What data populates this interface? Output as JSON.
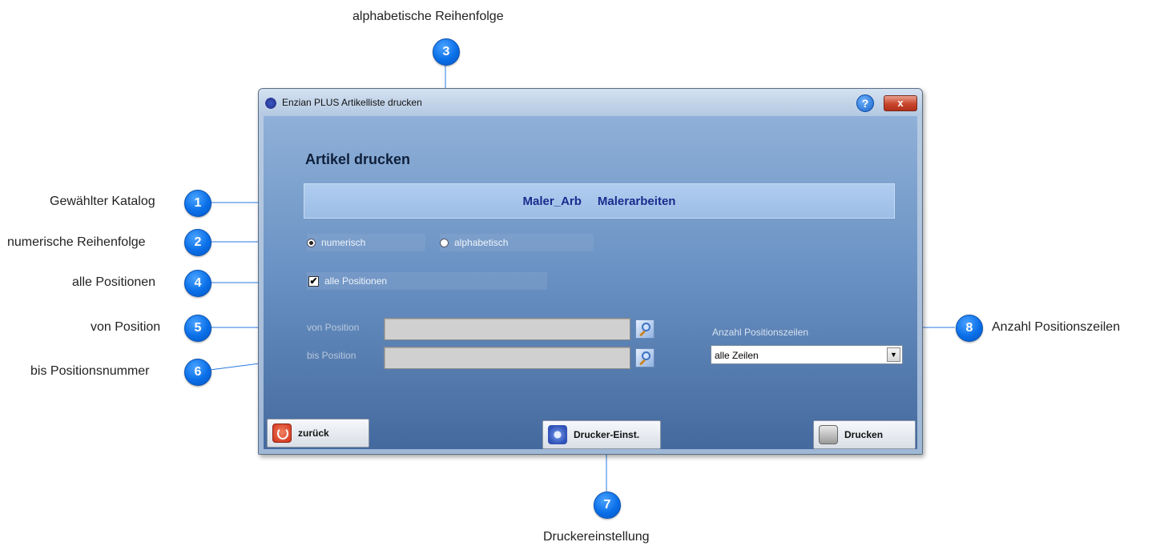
{
  "callouts": {
    "c1": {
      "number": "1",
      "label": "Gewählter Katalog"
    },
    "c2": {
      "number": "2",
      "label": "numerische Reihenfolge"
    },
    "c3": {
      "number": "3",
      "label": "alphabetische Reihenfolge"
    },
    "c4": {
      "number": "4",
      "label": "alle Positionen"
    },
    "c5": {
      "number": "5",
      "label": "von Position"
    },
    "c6": {
      "number": "6",
      "label": "bis Positionsnummer"
    },
    "c7": {
      "number": "7",
      "label": "Druckereinstellung"
    },
    "c8": {
      "number": "8",
      "label": "Anzahl Positionszeilen"
    }
  },
  "window": {
    "title": "Enzian PLUS Artikelliste drucken",
    "help_label": "?",
    "close_label": "x"
  },
  "dialog": {
    "heading": "Artikel drucken",
    "catalog_code": "Maler_Arb",
    "catalog_name": "Malerarbeiten",
    "radio_numerisch": "numerisch",
    "radio_alphabetisch": "alphabetisch",
    "checkbox_all_positions": "alle Positionen",
    "checkbox_mark": "✔",
    "von_label": "von Position",
    "bis_label": "bis Position",
    "von_value": "",
    "bis_value": "",
    "anzahl_label": "Anzahl Positionszeilen",
    "anzahl_value": "alle Zeilen",
    "select_arrow": "▼"
  },
  "buttons": {
    "back": "zurück",
    "printer_settings": "Drucker-Einst.",
    "print": "Drucken"
  }
}
